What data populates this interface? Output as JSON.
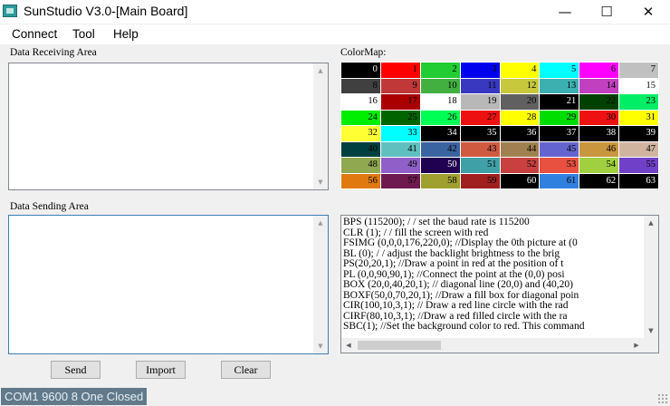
{
  "window": {
    "title": "SunStudio V3.0-[Main Board]",
    "controls": {
      "minimize": "—",
      "maximize": "☐",
      "close": "✕"
    }
  },
  "menu": [
    "Connect",
    "Tool",
    "Help"
  ],
  "receive": {
    "label": "Data Receiving Area",
    "text": ""
  },
  "send": {
    "label": "Data Sending Area",
    "text": ""
  },
  "colormap": {
    "label": "ColorMap:",
    "cells": [
      {
        "n": "0",
        "bg": "#000000",
        "fg": "#ffffff"
      },
      {
        "n": "1",
        "bg": "#ff0000",
        "fg": "#000000"
      },
      {
        "n": "2",
        "bg": "#22cc33",
        "fg": "#000000"
      },
      {
        "n": "3",
        "bg": "#0000ee",
        "fg": "#000000"
      },
      {
        "n": "4",
        "bg": "#ffff00",
        "fg": "#000000"
      },
      {
        "n": "5",
        "bg": "#00ffff",
        "fg": "#000000"
      },
      {
        "n": "6",
        "bg": "#ff00ff",
        "fg": "#000000"
      },
      {
        "n": "7",
        "bg": "#c0c0c0",
        "fg": "#000000"
      },
      {
        "n": "8",
        "bg": "#404040",
        "fg": "#000000"
      },
      {
        "n": "9",
        "bg": "#c03838",
        "fg": "#000000"
      },
      {
        "n": "10",
        "bg": "#42b040",
        "fg": "#000000"
      },
      {
        "n": "11",
        "bg": "#3838c0",
        "fg": "#000000"
      },
      {
        "n": "12",
        "bg": "#c8c83c",
        "fg": "#000000"
      },
      {
        "n": "13",
        "bg": "#3cb0b0",
        "fg": "#000000"
      },
      {
        "n": "14",
        "bg": "#c040c0",
        "fg": "#000000"
      },
      {
        "n": "15",
        "bg": "#ffffff",
        "fg": "#000000"
      },
      {
        "n": "16",
        "bg": "#ffffff",
        "fg": "#000000"
      },
      {
        "n": "17",
        "bg": "#aa0000",
        "fg": "#000000"
      },
      {
        "n": "18",
        "bg": "#ffffff",
        "fg": "#000000"
      },
      {
        "n": "19",
        "bg": "#b8b8b8",
        "fg": "#000000"
      },
      {
        "n": "20",
        "bg": "#606060",
        "fg": "#000000"
      },
      {
        "n": "21",
        "bg": "#000000",
        "fg": "#ffffff"
      },
      {
        "n": "22",
        "bg": "#004000",
        "fg": "#000000"
      },
      {
        "n": "23",
        "bg": "#00ee66",
        "fg": "#000000"
      },
      {
        "n": "24",
        "bg": "#00ee00",
        "fg": "#000000"
      },
      {
        "n": "25",
        "bg": "#006400",
        "fg": "#000000"
      },
      {
        "n": "26",
        "bg": "#00ff55",
        "fg": "#000000"
      },
      {
        "n": "27",
        "bg": "#ee1111",
        "fg": "#000000"
      },
      {
        "n": "28",
        "bg": "#ffff00",
        "fg": "#000000"
      },
      {
        "n": "29",
        "bg": "#00dd00",
        "fg": "#000000"
      },
      {
        "n": "30",
        "bg": "#ee1111",
        "fg": "#000000"
      },
      {
        "n": "31",
        "bg": "#ffff00",
        "fg": "#000000"
      },
      {
        "n": "32",
        "bg": "#ffff33",
        "fg": "#000000"
      },
      {
        "n": "33",
        "bg": "#00ffff",
        "fg": "#000000"
      },
      {
        "n": "34",
        "bg": "#000000",
        "fg": "#ffffff"
      },
      {
        "n": "35",
        "bg": "#000000",
        "fg": "#ffffff"
      },
      {
        "n": "36",
        "bg": "#000000",
        "fg": "#ffffff"
      },
      {
        "n": "37",
        "bg": "#000000",
        "fg": "#ffffff"
      },
      {
        "n": "38",
        "bg": "#000000",
        "fg": "#ffffff"
      },
      {
        "n": "39",
        "bg": "#000000",
        "fg": "#ffffff"
      },
      {
        "n": "40",
        "bg": "#004040",
        "fg": "#000000"
      },
      {
        "n": "41",
        "bg": "#60c0c0",
        "fg": "#000000"
      },
      {
        "n": "42",
        "bg": "#3a64a0",
        "fg": "#000000"
      },
      {
        "n": "43",
        "bg": "#d05a40",
        "fg": "#000000"
      },
      {
        "n": "44",
        "bg": "#a08050",
        "fg": "#000000"
      },
      {
        "n": "45",
        "bg": "#6464d0",
        "fg": "#000000"
      },
      {
        "n": "46",
        "bg": "#c8963c",
        "fg": "#000000"
      },
      {
        "n": "47",
        "bg": "#d0b4a0",
        "fg": "#000000"
      },
      {
        "n": "48",
        "bg": "#90a850",
        "fg": "#000000"
      },
      {
        "n": "49",
        "bg": "#9060c8",
        "fg": "#000000"
      },
      {
        "n": "50",
        "bg": "#200050",
        "fg": "#ffffff"
      },
      {
        "n": "51",
        "bg": "#40a0a8",
        "fg": "#000000"
      },
      {
        "n": "52",
        "bg": "#c84040",
        "fg": "#000000"
      },
      {
        "n": "53",
        "bg": "#e85040",
        "fg": "#000000"
      },
      {
        "n": "54",
        "bg": "#a0d040",
        "fg": "#000000"
      },
      {
        "n": "55",
        "bg": "#7040c8",
        "fg": "#000000"
      },
      {
        "n": "56",
        "bg": "#e07a10",
        "fg": "#000000"
      },
      {
        "n": "57",
        "bg": "#6e1a50",
        "fg": "#000000"
      },
      {
        "n": "58",
        "bg": "#a0a030",
        "fg": "#000000"
      },
      {
        "n": "59",
        "bg": "#a02020",
        "fg": "#000000"
      },
      {
        "n": "60",
        "bg": "#000000",
        "fg": "#ffffff"
      },
      {
        "n": "61",
        "bg": "#3080e0",
        "fg": "#000000"
      },
      {
        "n": "62",
        "bg": "#000000",
        "fg": "#ffffff"
      },
      {
        "n": "63",
        "bg": "#000000",
        "fg": "#ffffff"
      }
    ]
  },
  "commands": [
    "BPS (115200); / / set the baud rate is 115200",
    "CLR (1); / / fill the screen with red",
    "FSIMG (0,0,0,176,220,0); //Display the 0th picture at (0",
    "BL (0); / / adjust the backlight brightness to the brig",
    "PS(20,20,1); //Draw a point in red at the position of t",
    "PL (0,0,90,90,1); //Connect the point at the (0,0) posi",
    "BOX (20,0,40,20,1); // diagonal line (20,0) and (40,20)",
    "BOXF(50,0,70,20,1); //Draw a fill box for diagonal poin",
    "CIR(100,10,3,1); // Draw a red line circle with the rad",
    "CIRF(80,10,3,1); //Draw a red filled circle with the ra",
    "SBC(1); //Set the background color to red. This command"
  ],
  "buttons": {
    "send": "Send",
    "import": "Import",
    "clear": "Clear"
  },
  "status": "COM1 9600 8 One Closed",
  "icons": {
    "up": "▲",
    "down": "▼",
    "left": "◀",
    "right": "▶"
  }
}
